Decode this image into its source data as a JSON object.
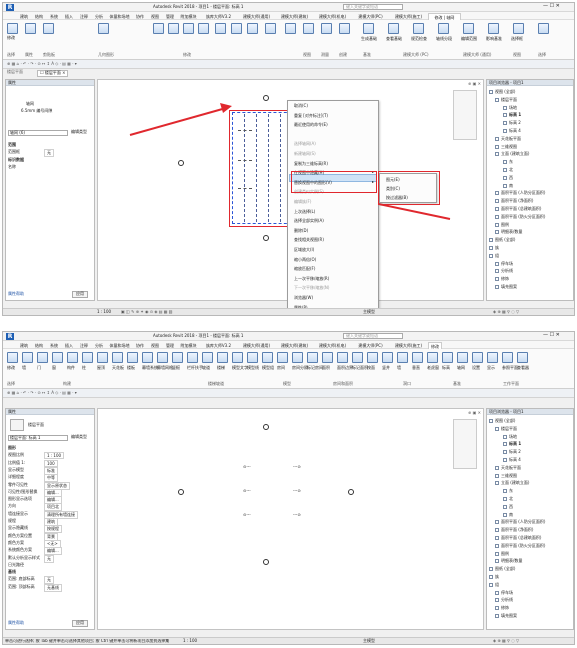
{
  "app": {
    "title_1": "Autodesk Revit 2018 - 项目1 - 楼层平面: 标高 1",
    "title_2": "Autodesk Revit 2018 - 项目1 - 楼层平面: 标高 1",
    "logo": "R",
    "search_placeholder": "键入关键字或短语",
    "window_controls": "— ☐ ✕"
  },
  "tabs_1": [
    "建筑",
    "结构",
    "系统",
    "插入",
    "注释",
    "分析",
    "体量和场地",
    "协作",
    "视图",
    "管理",
    "附加模块",
    "族库大师V3.2",
    "建模大师(通用)",
    "建模大师(建筑)",
    "建模大师(机电)",
    "建模大师(PC)",
    "建模大师(施工)",
    "修改 | 轴网"
  ],
  "tabs_2": [
    "建筑",
    "结构",
    "系统",
    "插入",
    "注释",
    "分析",
    "体量和场地",
    "协作",
    "视图",
    "管理",
    "附加模块",
    "族库大师V3.2",
    "建模大师(通用)",
    "建模大师(建筑)",
    "建模大师(机电)",
    "建模大师(PC)",
    "建模大师(施工)",
    "修改"
  ],
  "ribbon_1": {
    "groups": [
      "选择",
      "属性",
      "剪贴板",
      "几何图形",
      "修改",
      "视图",
      "测量",
      "创建",
      "基准",
      "建模大师 (PC)",
      "建模大师 (通用)",
      "视图",
      "选择"
    ],
    "modify": "修改",
    "extra_buttons": [
      "生成基础",
      "查看基础",
      "规范检查",
      "轴线分段",
      "编辑范围",
      "影响基准",
      "选择框"
    ]
  },
  "ribbon_2": {
    "groups": [
      "选择",
      "构建",
      "楼梯坡道",
      "模型",
      "房间和面积",
      "洞口",
      "基准",
      "工作平面"
    ],
    "buttons": [
      "修改",
      "墙",
      "门",
      "窗",
      "构件",
      "柱",
      "屋顶",
      "天花板",
      "楼板",
      "幕墙系统",
      "幕墙网格",
      "竖梃",
      "栏杆扶手",
      "坡道",
      "楼梯",
      "模型文字",
      "模型线",
      "模型组",
      "房间",
      "房间分隔",
      "标记房间",
      "面积",
      "面积边界",
      "标记面积",
      "按面",
      "竖井",
      "墙",
      "垂直",
      "老虎窗",
      "标高",
      "轴网",
      "设置",
      "显示",
      "参照平面",
      "查看器"
    ]
  },
  "view_label_1": "楼层平面",
  "view_label_2": "楼层平面",
  "props_1": {
    "header": "属性",
    "type_name": "轴网",
    "type_sub": "6.5mm 编号间隙",
    "selector": "轴网 (6)",
    "edit_type": "编辑类型",
    "rows": [
      {
        "k": "范围",
        "v": ""
      },
      {
        "k": "范围框",
        "v": "无"
      },
      {
        "k": "标识数据",
        "v": ""
      },
      {
        "k": "名称",
        "v": ""
      }
    ],
    "help": "属性帮助",
    "apply": "应用"
  },
  "props_2": {
    "header": "属性",
    "type_name": "楼层平面",
    "selector": "楼层平面: 标高 1",
    "edit_type": "编辑类型",
    "rows": [
      {
        "k": "图形",
        "v": ""
      },
      {
        "k": "视图比例",
        "v": "1 : 100"
      },
      {
        "k": "比例值 1:",
        "v": "100"
      },
      {
        "k": "显示模型",
        "v": "标准"
      },
      {
        "k": "详细程度",
        "v": "中等"
      },
      {
        "k": "零件可见性",
        "v": "显示原状态"
      },
      {
        "k": "可见性/图形替换",
        "v": "编辑..."
      },
      {
        "k": "图形显示选项",
        "v": "编辑..."
      },
      {
        "k": "方向",
        "v": "项目北"
      },
      {
        "k": "墙连接显示",
        "v": "清理所有墙连接"
      },
      {
        "k": "规程",
        "v": "建筑"
      },
      {
        "k": "显示隐藏线",
        "v": "按规程"
      },
      {
        "k": "颜色方案位置",
        "v": "背景"
      },
      {
        "k": "颜色方案",
        "v": "<无>"
      },
      {
        "k": "系统颜色方案",
        "v": "编辑..."
      },
      {
        "k": "默认分析显示样式",
        "v": "无"
      },
      {
        "k": "日光路径",
        "v": ""
      },
      {
        "k": "基线",
        "v": ""
      },
      {
        "k": "范围: 底部标高",
        "v": "无"
      },
      {
        "k": "范围: 顶部标高",
        "v": "无基线"
      }
    ],
    "help": "属性帮助",
    "apply": "应用"
  },
  "browser": {
    "header": "项目浏览器 - 项目1",
    "items": [
      "视图 (全部)",
      "楼层平面",
      "场地",
      "标高 1",
      "标高 2",
      "标高 4",
      "天花板平面",
      "三维视图",
      "立面 (建筑立面)",
      "东",
      "北",
      "西",
      "南",
      "面积平面 (人防分区面积)",
      "面积平面 (净面积)",
      "面积平面 (总建筑面积)",
      "面积平面 (防火分区面积)",
      "图例",
      "明细表/数量",
      "图纸 (全部)",
      "族",
      "组",
      "停车场",
      "分析线",
      "修饰",
      "填充图案"
    ]
  },
  "context_menu": {
    "items": [
      "取消(C)",
      "重复 [对齐标注](T)",
      "最近使用的命令(E)",
      "",
      "选择轴网(A)",
      "新建轴网(S)",
      "复制为三维标高(R)",
      "在视图中隐藏(H)",
      "替换视图中的图形(V)",
      "创建类似实例(S)",
      "编辑族(F)",
      "上次选择(L)",
      "选择全部实例(A)",
      "删除(D)",
      "查找相关视图(R)",
      "区域放大(I)",
      "缩小两倍(O)",
      "缩放匹配(F)",
      "上一次平移/缩放(R)",
      "下一次平移/缩放(N)",
      "浏览器(W)",
      "属性(P)"
    ],
    "highlighted": "在视图中隐藏(H)",
    "submenu": [
      "图元(E)",
      "类别(C)",
      "按过滤器(B)"
    ]
  },
  "status_1": {
    "scale": "1 : 100",
    "bar_icons": "▣ ◫ ✎ ⊕ ✦ ◉ ⊙ ◈ ▤ ▦ ▧",
    "filter": "0",
    "model": "主模型"
  },
  "status_2": {
    "hint": "单击可进行选择; 按 Tab 键并单击可选择其他项目; 按 Ctrl 键并单击可将新项目添加到选择集",
    "scale": "1 : 100",
    "model": "主模型",
    "filter": "0"
  },
  "canvas_2": {
    "grid_labels_left": [
      "⊙---",
      "⊙---",
      "⊙---"
    ],
    "grid_labels_right": [
      "---⊙",
      "---⊙",
      "---⊙"
    ]
  },
  "colors": {
    "accent": "#1e5fb4",
    "red": "#e0282e",
    "highlight": "#cfe3f7"
  }
}
